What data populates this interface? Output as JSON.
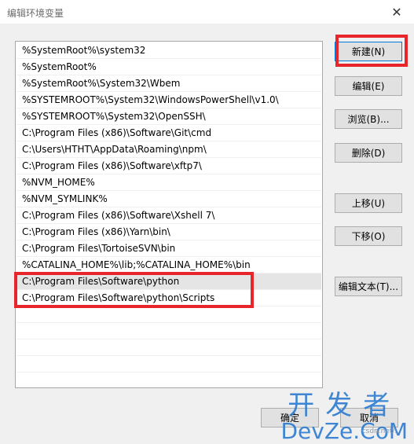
{
  "window": {
    "title": "编辑环境变量",
    "close_glyph": "✕"
  },
  "path_list": [
    "%SystemRoot%\\system32",
    "%SystemRoot%",
    "%SystemRoot%\\System32\\Wbem",
    "%SYSTEMROOT%\\System32\\WindowsPowerShell\\v1.0\\",
    "%SYSTEMROOT%\\System32\\OpenSSH\\",
    "C:\\Program Files (x86)\\Software\\Git\\cmd",
    "C:\\Users\\HTHT\\AppData\\Roaming\\npm\\",
    "C:\\Program Files (x86)\\Software\\xftp7\\",
    "%NVM_HOME%",
    "%NVM_SYMLINK%",
    "C:\\Program Files (x86)\\Software\\Xshell 7\\",
    "C:\\Program Files (x86)\\Yarn\\bin\\",
    "C:\\Program Files\\TortoiseSVN\\bin",
    "%CATALINA_HOME%\\lib;%CATALINA_HOME%\\bin",
    "C:\\Program Files\\Software\\python",
    "C:\\Program Files\\Software\\python\\Scripts"
  ],
  "selected_index": 14,
  "buttons": {
    "new": "新建(N)",
    "edit": "编辑(E)",
    "browse": "浏览(B)...",
    "delete": "删除(D)",
    "move_up": "上移(U)",
    "move_down": "下移(O)",
    "edit_text": "编辑文本(T)...",
    "ok": "确定",
    "cancel": "取消"
  },
  "watermark": {
    "chinese": "开发者",
    "english": "DevZe.CoM",
    "url": "csdn.net/..."
  },
  "colors": {
    "highlight": "#e8252b",
    "watermark": "#2b7bd1"
  }
}
